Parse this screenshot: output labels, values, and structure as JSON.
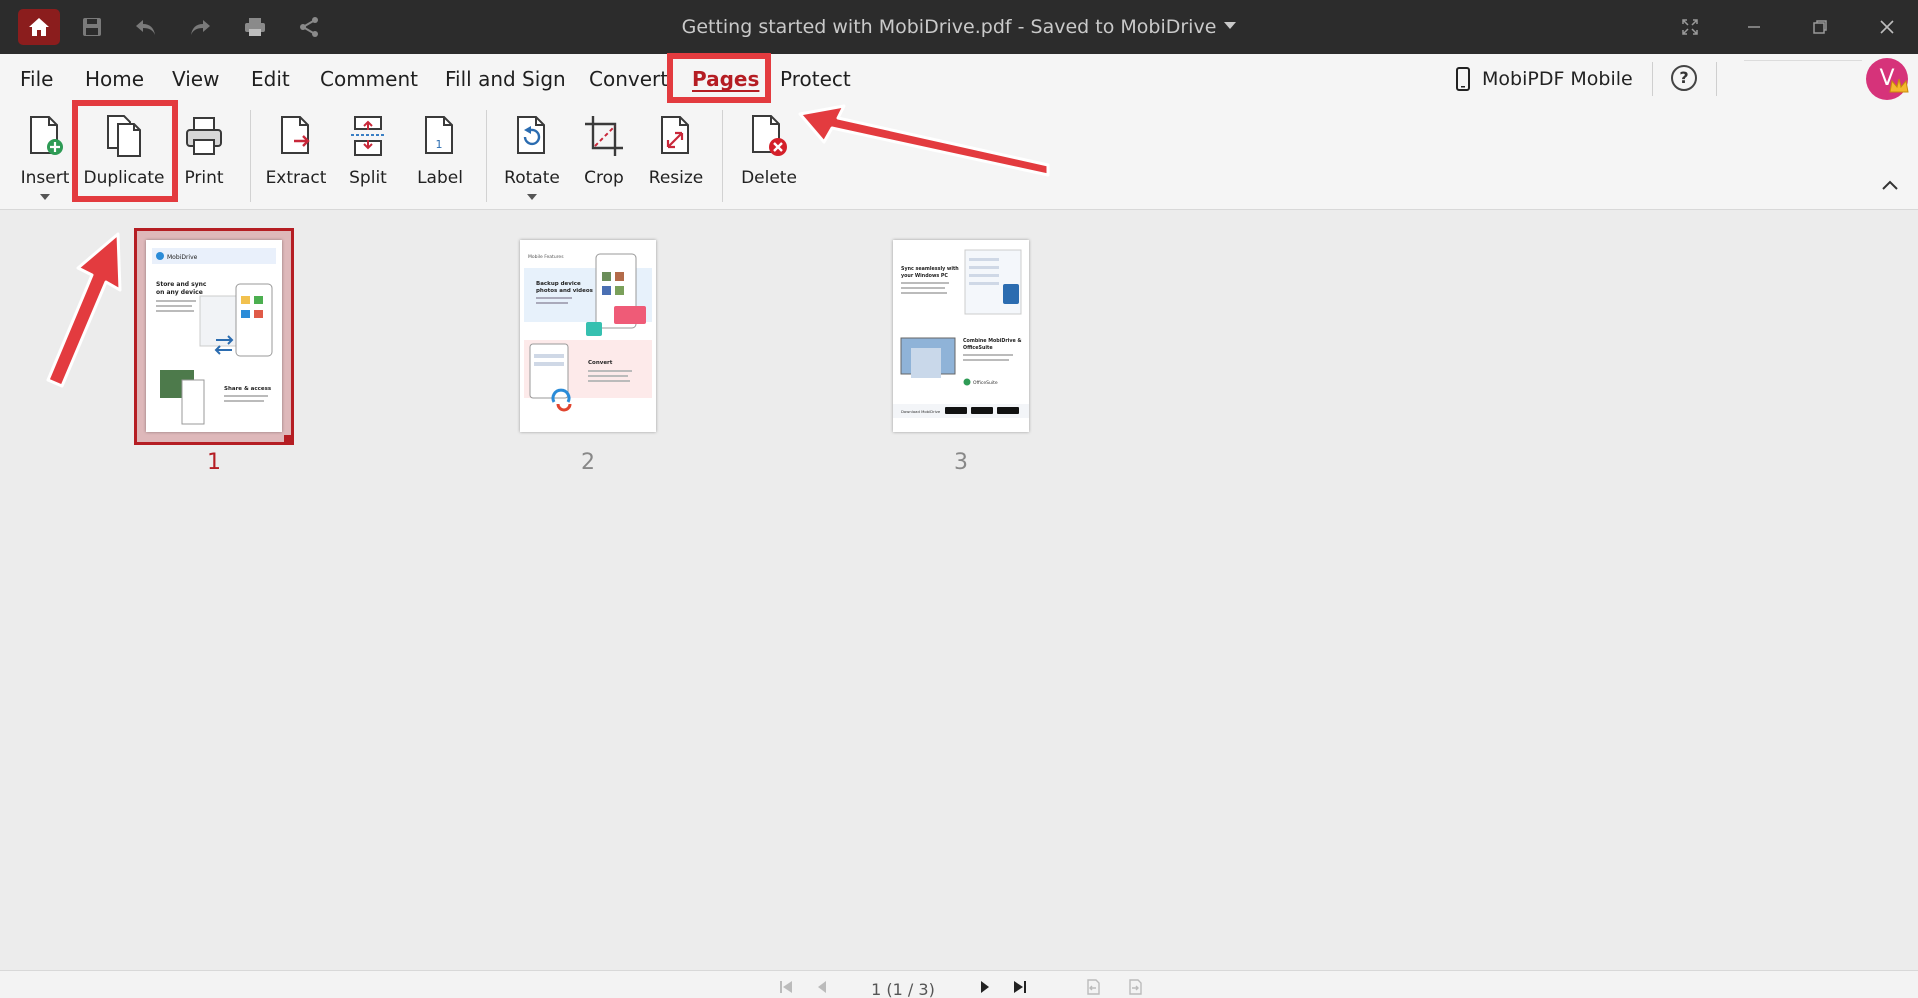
{
  "titlebar": {
    "title": "Getting started with MobiDrive.pdf - Saved to MobiDrive",
    "icons": [
      "home-icon",
      "save-icon",
      "undo-icon",
      "redo-icon",
      "print-icon",
      "share-icon"
    ],
    "window_controls": [
      "fullscreen-icon",
      "minimize-icon",
      "restore-icon",
      "close-icon"
    ]
  },
  "menu": {
    "items": [
      {
        "label": "File"
      },
      {
        "label": "Home"
      },
      {
        "label": "View"
      },
      {
        "label": "Edit"
      },
      {
        "label": "Comment"
      },
      {
        "label": "Fill and Sign"
      },
      {
        "label": "Convert"
      },
      {
        "label": "Pages",
        "active": true
      },
      {
        "label": "Protect"
      }
    ],
    "mobile_label": "MobiPDF Mobile",
    "help_label": "?",
    "avatar_initial": "V"
  },
  "ribbon": {
    "buttons": [
      {
        "label": "Insert",
        "icon": "insert-page-icon",
        "dropdown": true
      },
      {
        "label": "Duplicate",
        "icon": "duplicate-page-icon"
      },
      {
        "label": "Print",
        "icon": "print-icon"
      },
      {
        "label": "Extract",
        "icon": "extract-page-icon"
      },
      {
        "label": "Split",
        "icon": "split-page-icon"
      },
      {
        "label": "Label",
        "icon": "label-page-icon"
      },
      {
        "label": "Rotate",
        "icon": "rotate-page-icon",
        "dropdown": true
      },
      {
        "label": "Crop",
        "icon": "crop-icon"
      },
      {
        "label": "Resize",
        "icon": "resize-icon"
      },
      {
        "label": "Delete",
        "icon": "delete-page-icon"
      }
    ]
  },
  "pages": [
    {
      "number": "1",
      "selected": true
    },
    {
      "number": "2",
      "selected": false
    },
    {
      "number": "3",
      "selected": false
    }
  ],
  "thumbnails": {
    "p1": {
      "brand": "MobiDrive",
      "heading1": "Store and sync",
      "heading2": "on any device",
      "heading3": "Share & access"
    },
    "p2": {
      "label": "Mobile Features",
      "heading1": "Backup device",
      "heading2": "photos and videos",
      "heading3": "Convert"
    },
    "p3": {
      "heading1": "Sync seamlessly with",
      "heading2": "your Windows PC",
      "heading3": "Combine MobiDrive &",
      "heading4": "OfficeSuite",
      "brand": "OfficeSuite",
      "footer": "Download MobiDrive"
    }
  },
  "status": {
    "page_indicator": "1 (1 / 3)"
  },
  "colors": {
    "accent": "#b51d23",
    "highlight": "#e33b3f",
    "titlebar": "#2c2c2c"
  }
}
